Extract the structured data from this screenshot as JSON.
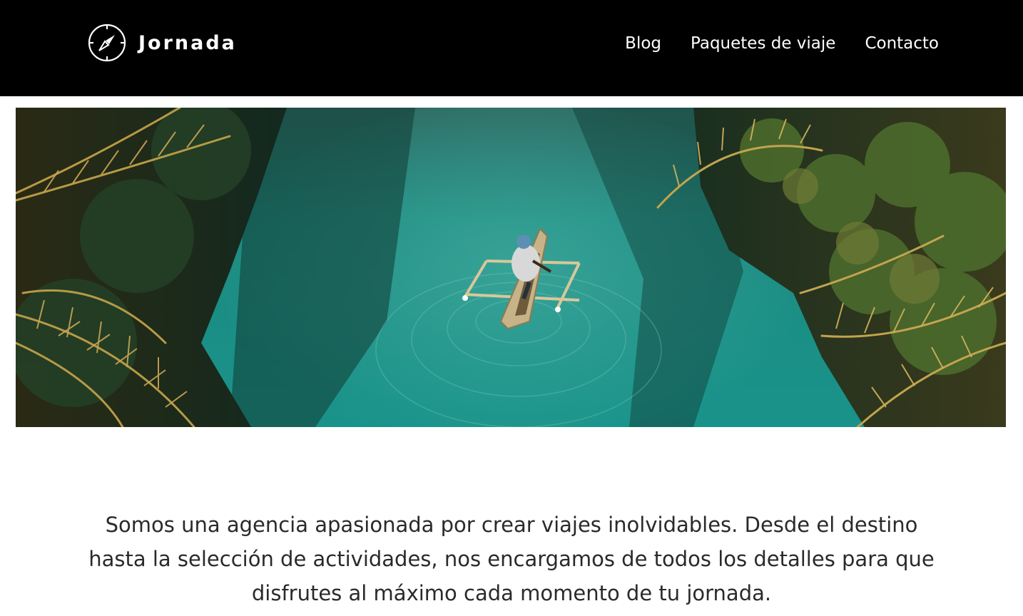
{
  "header": {
    "brand_name": "Jornada",
    "logo_icon": "compass-icon",
    "background": "#000000",
    "nav": [
      {
        "label": "Blog"
      },
      {
        "label": "Paquetes de viaje"
      },
      {
        "label": "Contacto"
      }
    ]
  },
  "hero": {
    "image": "aerial photo of a person rowing an outrigger canoe on a turquoise river between palm trees",
    "colors": {
      "water": "#1e8f86",
      "foliage": "#6f6a2e",
      "shadow": "#0f2a22"
    }
  },
  "intro": {
    "text": "Somos una agencia apasionada por crear viajes inolvidables. Desde el destino hasta la selección de actividades, nos encargamos de todos los detalles para que disfrutes al máximo cada momento de tu jornada."
  }
}
